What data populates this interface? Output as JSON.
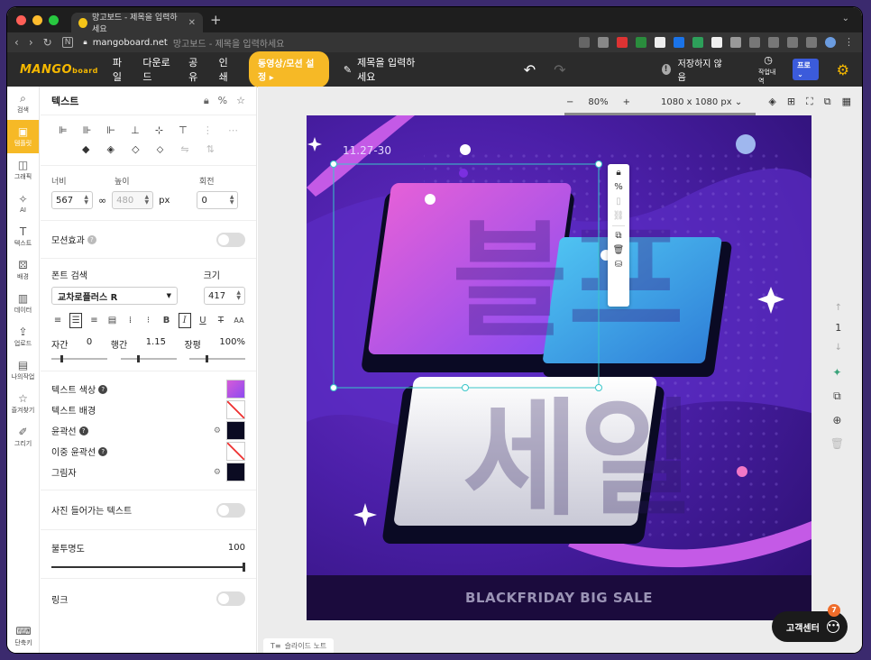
{
  "browser": {
    "tab_title": "망고보드 - 제목을 입력하세요",
    "url_domain": "mangoboard.net",
    "url_title": "망고보드 - 제목을 입력하세요"
  },
  "header": {
    "logo_main": "MANGO",
    "logo_sub": "board",
    "menu": [
      "파일",
      "다운로드",
      "공유",
      "인쇄"
    ],
    "animation_button": "동영상/모션 설정",
    "title_placeholder": "제목을 입력하세요",
    "save_status": "저장하지 않음",
    "history_label": "작업내역",
    "plan_badge": "프로"
  },
  "rail": {
    "items": [
      "검색",
      "템플릿",
      "그래픽",
      "AI",
      "텍스트",
      "배경",
      "데이터",
      "업로드",
      "나의작업",
      "즐겨찾기",
      "그리기"
    ],
    "shortcut": "단축키"
  },
  "panel": {
    "title": "텍스트",
    "width_label": "너비",
    "height_label": "높이",
    "rotation_label": "회전",
    "width_value": "567",
    "height_value": "480",
    "unit": "px",
    "rotation_value": "0",
    "motion_label": "모션효과",
    "font_search_label": "폰트 검색",
    "size_label": "크기",
    "font_name": "교차로플러스 R",
    "font_size": "417",
    "letter_spacing_label": "자간",
    "letter_spacing_value": "0",
    "line_height_label": "행간",
    "line_height_value": "1.15",
    "scale_label": "장평",
    "scale_value": "100%",
    "text_color_label": "텍스트 색상",
    "text_bg_label": "텍스트 배경",
    "outline_label": "윤곽선",
    "double_outline_label": "이중 윤곽선",
    "shadow_label": "그림자",
    "photo_text_label": "사진 들어가는 텍스트",
    "opacity_label": "불투명도",
    "opacity_value": "100",
    "link_label": "링크"
  },
  "workspace": {
    "zoom": "80%",
    "canvas_size": "1080 x 1080 px",
    "page_number": "1",
    "slide_note": "슬라이드 노트",
    "support_label": "고객센터",
    "support_badge": "7"
  },
  "artboard": {
    "date": "11.27-30",
    "headline_top": "블프",
    "headline_bottom": "세일",
    "bottom_banner": "BLACKFRIDAY BIG SALE"
  },
  "colors": {
    "accent": "#f6b926",
    "app_header": "#2b2b2b",
    "artboard_bg": "#4b1fa8",
    "headline_grad_start": "#e05fd6",
    "headline_grad_end": "#8b4cf0",
    "headline_cyan": "#3aa7e8"
  }
}
